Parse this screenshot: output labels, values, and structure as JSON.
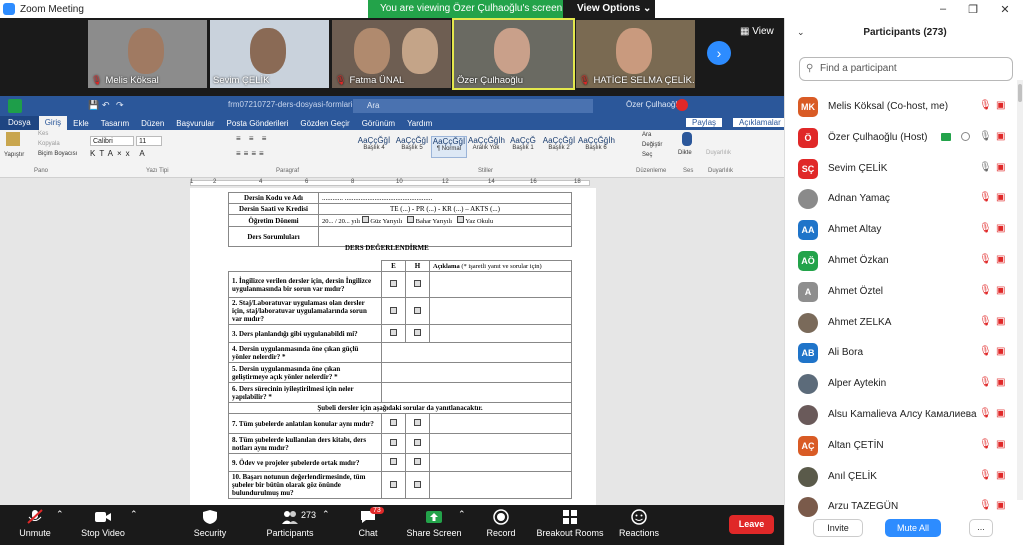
{
  "window": {
    "title": "Zoom Meeting"
  },
  "banner": {
    "viewing": "You are viewing Özer Çulhaoğlu's screen",
    "options": "View Options"
  },
  "video": {
    "tiles": [
      {
        "name": "Melis Köksal"
      },
      {
        "name": "Sevim ÇELİK"
      },
      {
        "name": "Fatma ÜNAL"
      },
      {
        "name": "Özer Çulhaoğlu"
      },
      {
        "name": "HATİCE SELMA ÇELİK..."
      }
    ],
    "view_label": "View"
  },
  "word": {
    "filename": "frm07210727-ders-dosyasi-formlari-_dh8Dcib - Word",
    "search": "Ara",
    "user": "Özer Çulhaoğlu",
    "tabs": [
      "Dosya",
      "Giriş",
      "Ekle",
      "Tasarım",
      "Düzen",
      "Başvurular",
      "Posta Gönderileri",
      "Gözden Geçir",
      "Görünüm",
      "Yardım"
    ],
    "share": "Paylaş",
    "comments": "Açıklamalar",
    "clipboard": {
      "paste": "Yapıştır",
      "cut": "Kes",
      "copy": "Kopyala",
      "format": "Biçim Boyacısı",
      "group": "Pano"
    },
    "font": {
      "name": "Calibri",
      "size": "11",
      "group": "Yazı Tipi"
    },
    "paragraph_group": "Paragraf",
    "styles": [
      {
        "sample": "AaÇçĞğİ",
        "label": "Başlık 4"
      },
      {
        "sample": "AaÇçĞğİ",
        "label": "Başlık 5"
      },
      {
        "sample": "AaÇçĞğİ",
        "label": "¶ Normal"
      },
      {
        "sample": "AaÇçĞğİh",
        "label": "Aralık Yok"
      },
      {
        "sample": "AaÇçĞ",
        "label": "Başlık 1"
      },
      {
        "sample": "AaÇçĞğİ",
        "label": "Başlık 2"
      },
      {
        "sample": "AaÇçĞğİh",
        "label": "Başlık 6"
      }
    ],
    "styles_group": "Stiller",
    "edit": {
      "find": "Ara",
      "replace": "Değiştir",
      "select": "Seç",
      "group": "Düzenleme"
    },
    "voice": {
      "dictate": "Dikte",
      "group": "Ses"
    },
    "sensitivity": {
      "label": "Duyarlılık",
      "group": "Duyarlılık"
    },
    "ruler": [
      "1",
      "2",
      "4",
      "6",
      "8",
      "10",
      "12",
      "14",
      "16",
      "18"
    ]
  },
  "form": {
    "course_code": "Dersin Kodu ve Adı",
    "course_code_value": "............ ..................................................",
    "course_hours": "Dersin Saati ve Kredisi",
    "course_hours_value": "TE (...) - PR (...) - KR (...) – AKTS (...)",
    "term": "Öğretim Dönemi",
    "term_value": "20... / 20... yılı",
    "term_opts": [
      "Güz Yarıyılı",
      "Bahar Yarıyılı",
      "Yaz Okulu"
    ],
    "instructors": "Ders Sorumluları",
    "section_title": "DERS DEĞERLENDİRME",
    "col_e": "E",
    "col_h": "H",
    "col_desc": "Açıklama (* işaretli yanıt ve sorular için)",
    "q1": "1. İngilizce verilen dersler için, dersin İngilizce uygulanmasında bir sorun var mıdır?",
    "q2": "2. Staj/Laboratuvar uygulaması olan dersler için, staj/laboratuvar uygulamalarında sorun var mıdır?",
    "q3": "3. Ders planlandığı gibi uygulanabildi mi?",
    "q4": "4. Dersin uygulanmasında öne çıkan güçlü yönler nelerdir? *",
    "q5": "5. Dersin uygulanmasında öne çıkan geliştirmeye açık yönler nelerdir? *",
    "q6": "6. Ders sürecinin iyileştirilmesi için neler yapılabilir? *",
    "section2": "Şubeli dersler için aşağıdaki sorular da yanıtlanacaktır.",
    "q7": "7. Tüm şubelerde anlatılan konular aynı mıdır?",
    "q8": "8. Tüm şubelerde kullanılan ders kitabı, ders notları aynı mıdır?",
    "q9": "9. Ödev ve projeler şubelerde ortak mıdır?",
    "q10": "10. Başarı notunun değerlendirmesinde, tüm şubeler bir bütün olarak göz önünde bulundurulmuş mu?"
  },
  "toolbar": {
    "unmute": "Unmute",
    "stop_video": "Stop Video",
    "security": "Security",
    "participants": "Participants",
    "participants_count": "273",
    "chat": "Chat",
    "chat_badge": "73",
    "share_screen": "Share Screen",
    "record": "Record",
    "breakout": "Breakout Rooms",
    "reactions": "Reactions",
    "leave": "Leave"
  },
  "panel": {
    "title": "Participants (273)",
    "search_placeholder": "Find a participant",
    "invite": "Invite",
    "mute_all": "Mute All",
    "more": "...",
    "participants": [
      {
        "initials": "MK",
        "name": "Melis Köksal (Co-host, me)",
        "color": "#d95b25",
        "mic": "muted",
        "cam": "off"
      },
      {
        "initials": "Ö",
        "name": "Özer Çulhaoğlu (Host)",
        "color": "#e02828",
        "mic": "on",
        "cam": "off"
      },
      {
        "initials": "SÇ",
        "name": "Sevim ÇELİK",
        "color": "#e02828",
        "mic": "on",
        "cam": "off"
      },
      {
        "initials": "",
        "name": "Adnan Yamaç",
        "color": "#8a8a8a",
        "mic": "muted",
        "cam": "off"
      },
      {
        "initials": "AA",
        "name": "Ahmet Altay",
        "color": "#1f74c9",
        "mic": "muted",
        "cam": "off"
      },
      {
        "initials": "AÖ",
        "name": "Ahmet Özkan",
        "color": "#23a34a",
        "mic": "muted",
        "cam": "off"
      },
      {
        "initials": "A",
        "name": "Ahmet Öztel",
        "color": "#8e8e8e",
        "mic": "muted",
        "cam": "off"
      },
      {
        "initials": "",
        "name": "Ahmet ZELKA",
        "color": "#7a6a5a",
        "mic": "muted",
        "cam": "off"
      },
      {
        "initials": "AB",
        "name": "Ali Bora",
        "color": "#1f74c9",
        "mic": "muted",
        "cam": "off"
      },
      {
        "initials": "",
        "name": "Alper Aytekin",
        "color": "#5c6b7a",
        "mic": "muted",
        "cam": "off"
      },
      {
        "initials": "",
        "name": "Alsu Kamalieva Алсу Камалиева",
        "color": "#6a5a5a",
        "mic": "muted",
        "cam": "off"
      },
      {
        "initials": "AÇ",
        "name": "Altan ÇETİN",
        "color": "#d95b25",
        "mic": "muted",
        "cam": "off"
      },
      {
        "initials": "",
        "name": "Anıl ÇELİK",
        "color": "#5a5a4a",
        "mic": "muted",
        "cam": "off"
      },
      {
        "initials": "",
        "name": "Arzu TAZEGÜN",
        "color": "#7a5a4a",
        "mic": "muted",
        "cam": "off"
      }
    ]
  }
}
